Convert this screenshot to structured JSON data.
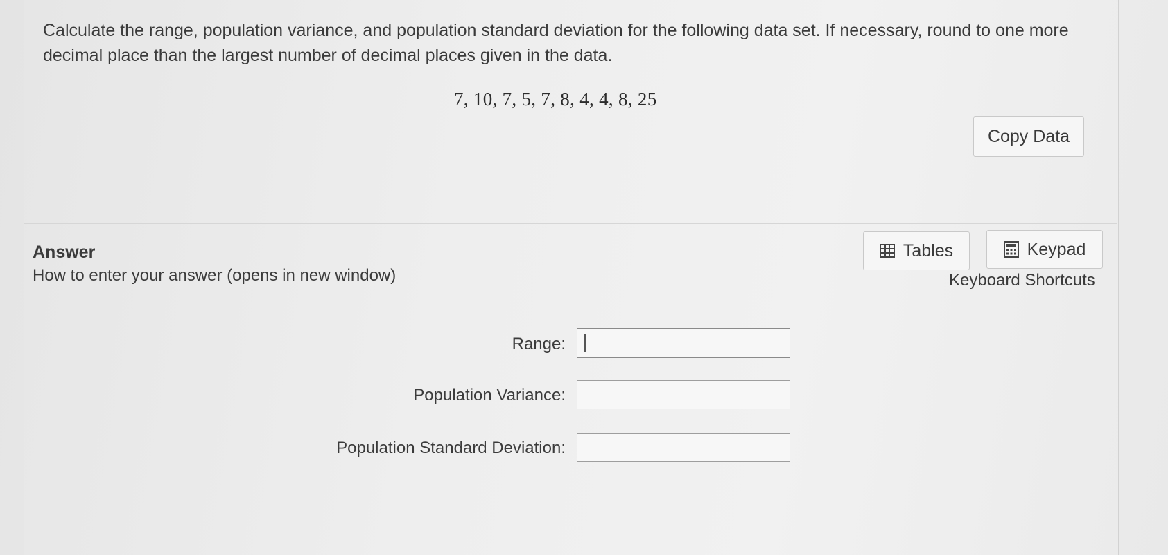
{
  "question": {
    "text": "Calculate the range, population variance, and population standard deviation for the following data set. If necessary, round to one more decimal place than the largest number of decimal places given in the data.",
    "dataset": "7, 10, 7, 5, 7, 8, 4, 4, 8, 25",
    "copy_data_label": "Copy Data"
  },
  "answer": {
    "title": "Answer",
    "how_to_link": "How to enter your answer (opens in new window)",
    "tables_label": "Tables",
    "keypad_label": "Keypad",
    "shortcuts_label": "Keyboard Shortcuts",
    "fields": [
      {
        "label": "Range:",
        "value": ""
      },
      {
        "label": "Population Variance:",
        "value": ""
      },
      {
        "label": "Population Standard Deviation:",
        "value": ""
      }
    ]
  },
  "icons": {
    "tables": "table-grid-icon",
    "keypad": "calculator-icon"
  }
}
